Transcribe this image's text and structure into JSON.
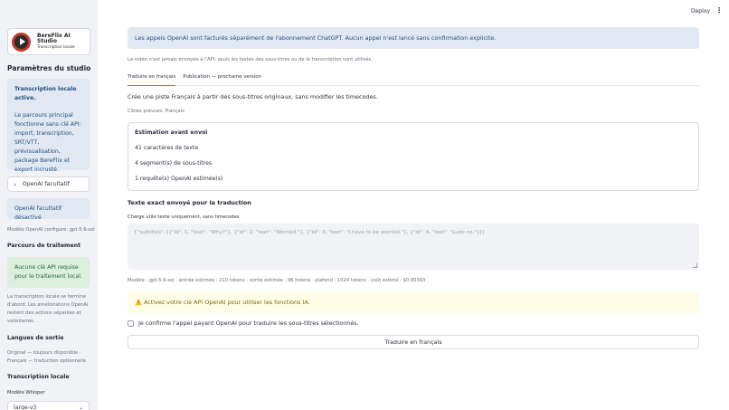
{
  "topbar": {
    "deploy_label": "Deploy",
    "menu_icon": "⋮"
  },
  "sidebar": {
    "logo": {
      "title": "BereFlix AI Studio",
      "subtitle": "Transcription locale"
    },
    "settings_heading": "Paramètres du studio",
    "local_card": {
      "title_line1": "Transcription locale",
      "title_line2": "active.",
      "paragraph": "Le parcours principal fonctionne sans clé API: import, transcription, SRT/VTT, prévisualisation, package BereFlix et export incrusté."
    },
    "openai_expander": {
      "label": "OpenAI facultatif",
      "icon": "chevron-right"
    },
    "openai_disabled": "OpenAI facultatif désactivé",
    "model_configured": "Modèle OpenAI configuré: gpt-5.6-sol",
    "processing_heading": "Parcours de traitement",
    "processing_warning": "Aucune clé API requise pour le traitement local.",
    "processing_explain": "La transcription locale se termine d'abord. Les améliorations OpenAI restent des actions séparées et volontaires.",
    "languages_heading": "Langues de sortie",
    "languages_text": "Original — toujours disponible · Français — traduction optionnelle",
    "transcription_heading": "Transcription locale",
    "whisper_label": "Modèle Whisper",
    "whisper_value": "large-v3"
  },
  "main": {
    "billing_banner": "Les appels OpenAI sont facturés séparément de l'abonnement ChatGPT. Aucun appel n'est lancé sans confirmation explicite.",
    "video_caption": "La vidéo n'est jamais envoyée à l'API: seuls les textes des sous-titres ou de la transcription sont utilisés.",
    "tabs": [
      {
        "label": "Traduire en français",
        "active": true
      },
      {
        "label": "Publication — prochaine version",
        "active": false
      }
    ],
    "create_text": "Crée une piste Français à partir des sous-titres originaux, sans modifier les timecodes.",
    "targets_caption": "Cibles prévues: Français",
    "estimate": {
      "title": "Estimation avant envoi",
      "characters": "41 caractères de texte",
      "segments": "4 segment(s) de sous-titres",
      "requests": "1 requête(s) OpenAI estimée(s)"
    },
    "exact_heading": "Texte exact envoyé pour la traduction",
    "charge_caption": "Charge utile texte uniquement, sans timecodes",
    "payload": "{\"subtitles\": [{\"id\": 1, \"text\": \"Why?\"}, {\"id\": 2, \"text\": \"Worried.\"}, {\"id\": 3, \"text\": \"I have to be worried.\"}, {\"id\": 4, \"text\": \"Ludo no.\"}]}",
    "model_caption": "Modèle : gpt-5.6-sol · entrée estimée : 210 tokens · sortie estimée : 96 tokens · plafond : 1024 tokens · coût estimé : $0.00393",
    "warning_icon": "⚠️",
    "warning_text": "Activez votre clé API OpenAI pour utiliser les fonctions IA.",
    "confirm_label": "Je confirme l'appel payant OpenAI pour traduire les sous-titres sélectionnés.",
    "translate_button": "Traduire en français"
  },
  "colors": {
    "sidebar_bg": "#f0f2f6",
    "info_bg": "#e1e8f2",
    "success_bg": "#dcefdc",
    "warning_bg": "#fffce7",
    "accent": "#ff4b4b"
  }
}
